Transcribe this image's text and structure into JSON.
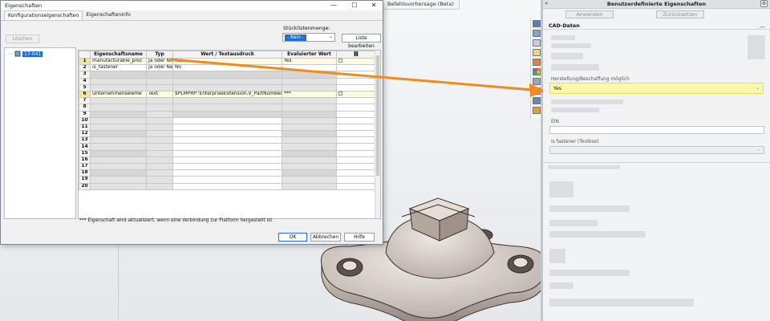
{
  "dialog": {
    "title": "Eigenschaften",
    "win_min": "—",
    "win_max": "☐",
    "win_close": "✕",
    "tabs": [
      "Konfigurationseigenschaften",
      "Eigenschafteninfo"
    ],
    "delete_label": "Löschen",
    "bom_qty_label": "Stücklistenmenge:",
    "bom_qty_value": "- Kein -",
    "edit_list_label": "Liste bearbeiten",
    "tree_config": "17-041",
    "columns": [
      "",
      "Eigenschaftsname",
      "Typ",
      "Wert / Textausdruck",
      "Evaluierter Wert",
      ""
    ],
    "rows": [
      {
        "num": "1",
        "name": "manufacturable_proc",
        "type": "Ja oder Nei",
        "value": "Yes",
        "evaluated": "Yes"
      },
      {
        "num": "2",
        "name": "is_fastener",
        "type": "Ja oder Nei",
        "value": "No",
        "evaluated": ""
      },
      {
        "num": "3",
        "name": "",
        "type": "",
        "value": "",
        "evaluated": ""
      },
      {
        "num": "4",
        "name": "",
        "type": "",
        "value": "",
        "evaluated": ""
      },
      {
        "num": "5",
        "name": "",
        "type": "",
        "value": "",
        "evaluated": ""
      },
      {
        "num": "6",
        "name": "Unternehmenseleme",
        "type": "Text",
        "value": "$PLMPRP:'EnterpriseExtension.V_PartNumber'",
        "evaluated": "***"
      },
      {
        "num": "7",
        "name": "",
        "type": "",
        "value": "",
        "evaluated": ""
      },
      {
        "num": "8",
        "name": "",
        "type": "",
        "value": "",
        "evaluated": ""
      },
      {
        "num": "9",
        "name": "",
        "type": "",
        "value": "",
        "evaluated": ""
      },
      {
        "num": "10",
        "name": "",
        "type": "",
        "value": "",
        "evaluated": ""
      },
      {
        "num": "11",
        "name": "",
        "type": "",
        "value": "",
        "evaluated": ""
      },
      {
        "num": "12",
        "name": "",
        "type": "",
        "value": "",
        "evaluated": ""
      },
      {
        "num": "13",
        "name": "",
        "type": "",
        "value": "",
        "evaluated": ""
      },
      {
        "num": "14",
        "name": "",
        "type": "",
        "value": "",
        "evaluated": ""
      },
      {
        "num": "15",
        "name": "",
        "type": "",
        "value": "",
        "evaluated": ""
      },
      {
        "num": "16",
        "name": "",
        "type": "",
        "value": "",
        "evaluated": ""
      },
      {
        "num": "17",
        "name": "",
        "type": "",
        "value": "",
        "evaluated": ""
      },
      {
        "num": "18",
        "name": "",
        "type": "",
        "value": "",
        "evaluated": ""
      },
      {
        "num": "19",
        "name": "",
        "type": "",
        "value": "",
        "evaluated": ""
      },
      {
        "num": "20",
        "name": "",
        "type": "",
        "value": "",
        "evaluated": ""
      }
    ],
    "footnote": "*** Eigenschaft wird aktualisiert, wenn eine Verbindung zur Platform hergestellt ist",
    "ok_label": "OK",
    "cancel_label": "Abbrechen",
    "help_label": "Hilfe"
  },
  "viewport": {
    "tab_label": "Befehlsvorhersage (Beta)"
  },
  "panel": {
    "title": "Benutzerdefinierte Eigenschaften",
    "collapse_icon": "«",
    "gear_icon": "⚙",
    "apply_label": "Anwenden",
    "reset_label": "Zurücksetzen",
    "section_title": "CAD-Daten",
    "section_chevron": "︿",
    "fields": {
      "manufacture_label": "Herstellung/Beschaffung möglich",
      "manufacture_value": "Yes",
      "ein_label": "EIN",
      "fastener_label": "is fastener (Toolbox)"
    }
  },
  "colors": {
    "highlight_yellow": "#fbf8ae",
    "arrow_orange": "#f28a1e",
    "selection_blue": "#1d6fd2"
  }
}
